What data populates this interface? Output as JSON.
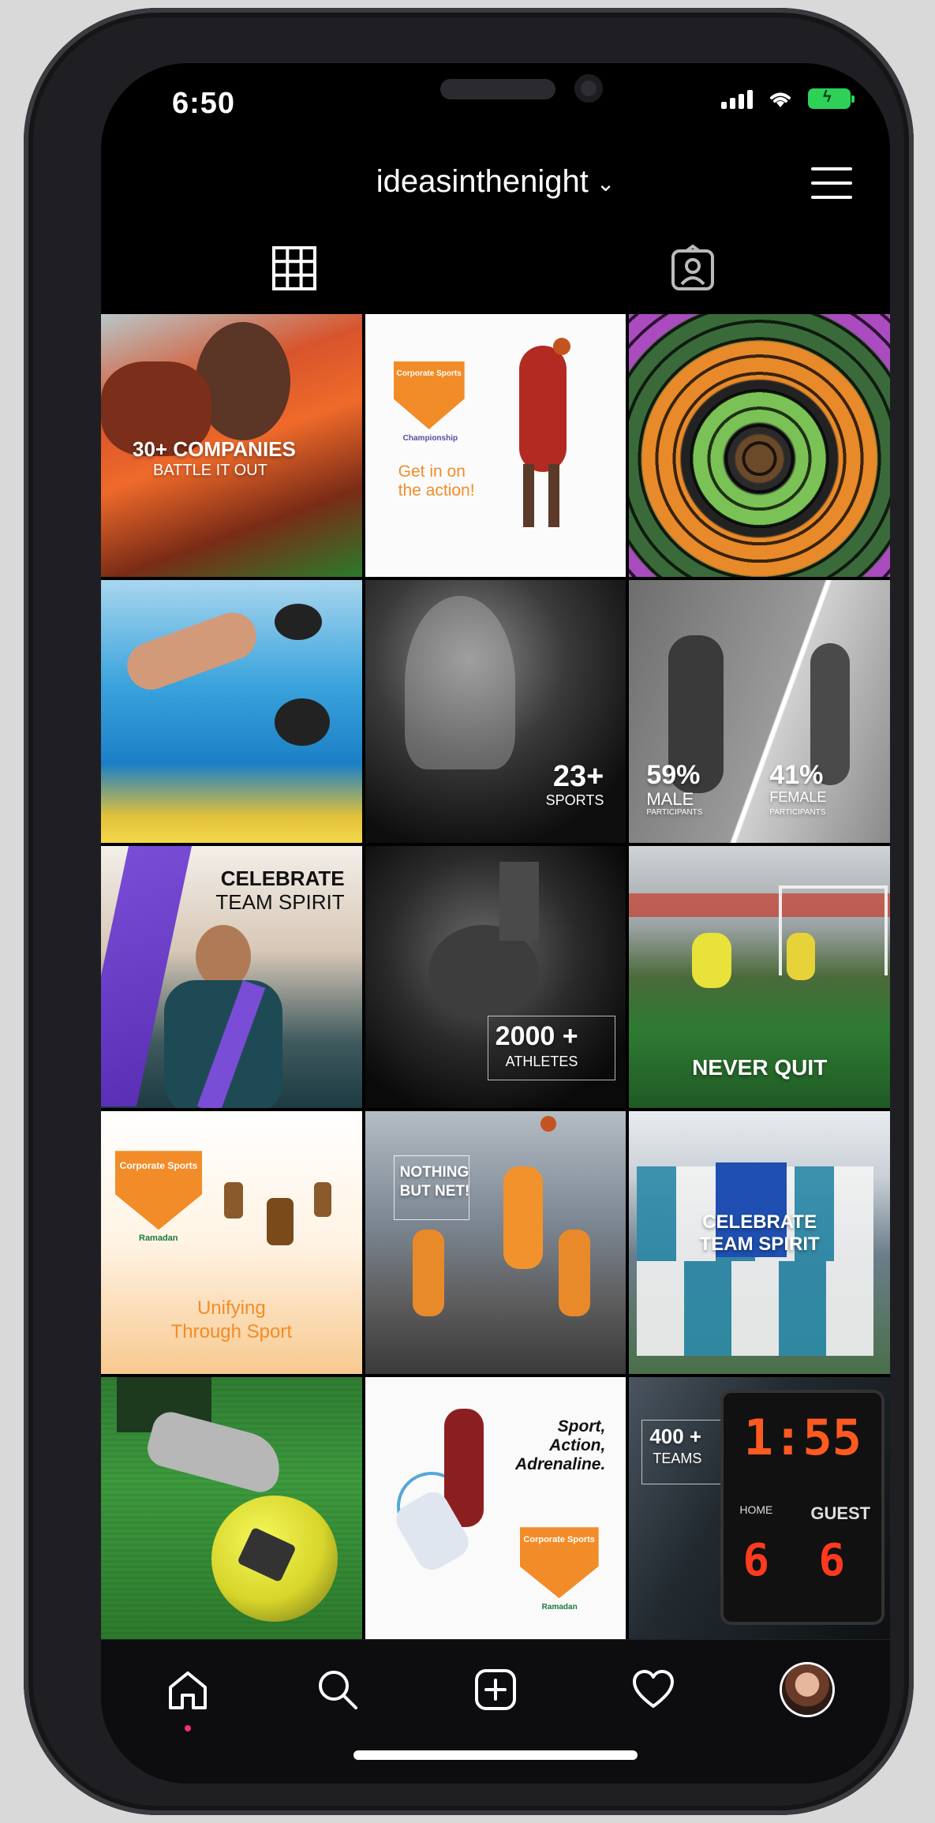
{
  "status_bar": {
    "time": "6:50"
  },
  "header": {
    "username": "ideasinthenight",
    "chevron": "⌄"
  },
  "tabs": [
    {
      "name": "grid-tab",
      "icon": "grid-icon"
    },
    {
      "name": "tagged-tab",
      "icon": "tagged-person-icon"
    }
  ],
  "posts": [
    {
      "id": 1,
      "headline": "30+ COMPANIES",
      "subline": "BATTLE IT OUT"
    },
    {
      "id": 2,
      "badge": "Corporate Sports",
      "badge_sub": "Championship",
      "text": "Get in on the action!"
    },
    {
      "id": 3
    },
    {
      "id": 4
    },
    {
      "id": 5,
      "number": "23+",
      "label": "SPORTS"
    },
    {
      "id": 6,
      "left_number": "59%",
      "left_label": "MALE",
      "left_sub": "PARTICIPANTS",
      "right_number": "41%",
      "right_label": "FEMALE",
      "right_sub": "PARTICIPANTS"
    },
    {
      "id": 7,
      "line1": "CELEBRATE",
      "line2": "TEAM SPIRIT"
    },
    {
      "id": 8,
      "number": "2000 +",
      "label": "ATHLETES"
    },
    {
      "id": 9,
      "text": "NEVER QUIT"
    },
    {
      "id": 10,
      "badge": "Corporate Sports",
      "badge_sub": "Ramadan",
      "line1": "Unifying",
      "line2": "Through Sport"
    },
    {
      "id": 11,
      "line1": "NOTHING",
      "line2": "BUT NET!"
    },
    {
      "id": 12,
      "line1": "CELEBRATE",
      "line2": "TEAM SPIRIT"
    },
    {
      "id": 13
    },
    {
      "id": 14,
      "line1": "Sport,",
      "line2": "Action,",
      "line3": "Adrenaline.",
      "badge": "Corporate Sports",
      "badge_sub": "Ramadan"
    },
    {
      "id": 15,
      "number": "400 +",
      "label": "TEAMS",
      "clock": "1:55",
      "home_score": "6",
      "guest_score": "6",
      "home_label": "HOME",
      "guest_label": "GUEST"
    }
  ],
  "bottom_nav": [
    {
      "name": "home",
      "icon": "home-icon"
    },
    {
      "name": "search",
      "icon": "search-icon"
    },
    {
      "name": "create",
      "icon": "plus-square-icon"
    },
    {
      "name": "activity",
      "icon": "heart-icon"
    },
    {
      "name": "profile",
      "icon": "avatar"
    }
  ],
  "colors": {
    "accent_orange": "#f28c28",
    "battery_green": "#2ed158",
    "notification_dot": "#ff2d70"
  }
}
